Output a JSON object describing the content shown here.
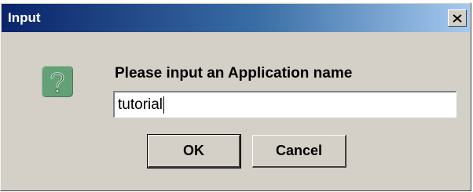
{
  "dialog": {
    "title": "Input",
    "close_icon": "close-icon",
    "icon": "question-icon",
    "prompt": "Please input an Application name",
    "input": {
      "value": "tutorial",
      "placeholder": ""
    },
    "buttons": {
      "ok_label": "OK",
      "cancel_label": "Cancel"
    }
  },
  "colors": {
    "titlebar_start": "#0a246a",
    "titlebar_end": "#a6caf0",
    "dialog_background": "#d4d0c8",
    "icon_background": "#5e9d72"
  }
}
